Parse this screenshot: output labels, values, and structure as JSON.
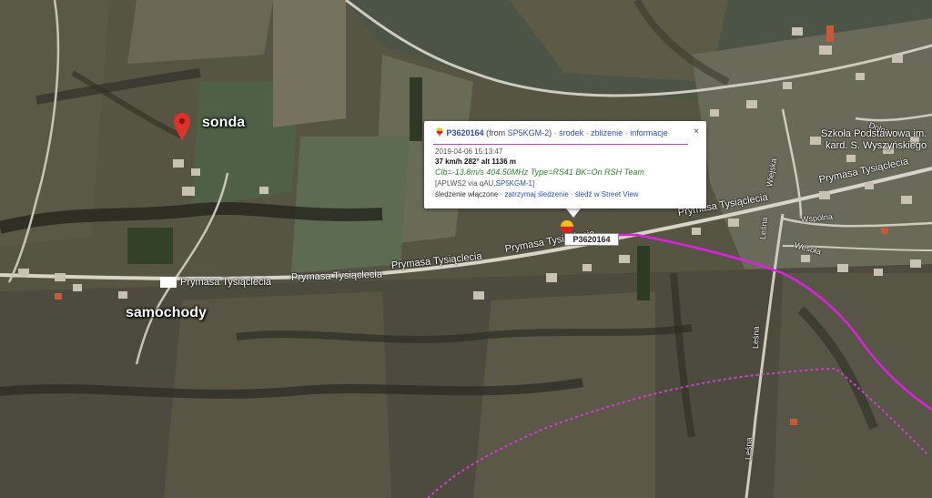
{
  "map": {
    "labels": {
      "sonda": "sonda",
      "samochody": "samochody"
    },
    "roads": {
      "prymasa": "Prymasa Tysiąclecia",
      "dolna": "Dolna",
      "wiejska": "Wiejska",
      "wspolna": "Wspólna",
      "lesna": "Leśna",
      "wesola": "Wesoła"
    },
    "places": {
      "school_line1": "Szkoła Podstawowa im.",
      "school_line2": "kard. S. Wyszyńskiego"
    },
    "track_color": "#e020e0",
    "track_dotted_color": "#d040d0"
  },
  "marker": {
    "callsign_label": "P3620164"
  },
  "popup": {
    "callsign": "P3620164",
    "from_prefix": "(from ",
    "from_station": "SP5KGM-2",
    "from_suffix": ")",
    "link_center": "środek",
    "link_zoom": "zbliżenie",
    "link_info": "informacje",
    "close": "×",
    "timestamp": "2019-04-06 15:13:47",
    "speed_line": "37 km/h 282° alt 1136 m",
    "comment": "Clb=-13.8m/s 404.50MHz Type=RS41 BK=On RSH Team",
    "path_prefix": "[APLWS2 via qAU,",
    "path_station": "SP5KGM-1",
    "path_suffix": "]",
    "tracking_status": "śledzenie włączone",
    "link_stop_tracking": "zatrzymaj śledzenie",
    "link_street_view": "śledź w Street View",
    "separator": "·"
  }
}
